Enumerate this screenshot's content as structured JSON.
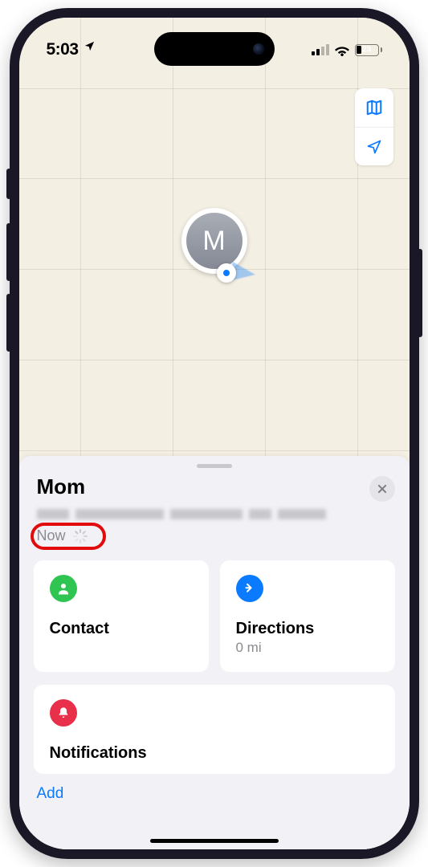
{
  "statusbar": {
    "time": "5:03",
    "battery_pct": "23"
  },
  "map": {
    "avatar_initial": "M"
  },
  "sheet": {
    "title": "Mom",
    "timestamp": "Now",
    "contact_card": {
      "title": "Contact"
    },
    "directions_card": {
      "title": "Directions",
      "distance": "0 mi"
    },
    "notifications_card": {
      "title": "Notifications"
    },
    "add_link": "Add"
  }
}
